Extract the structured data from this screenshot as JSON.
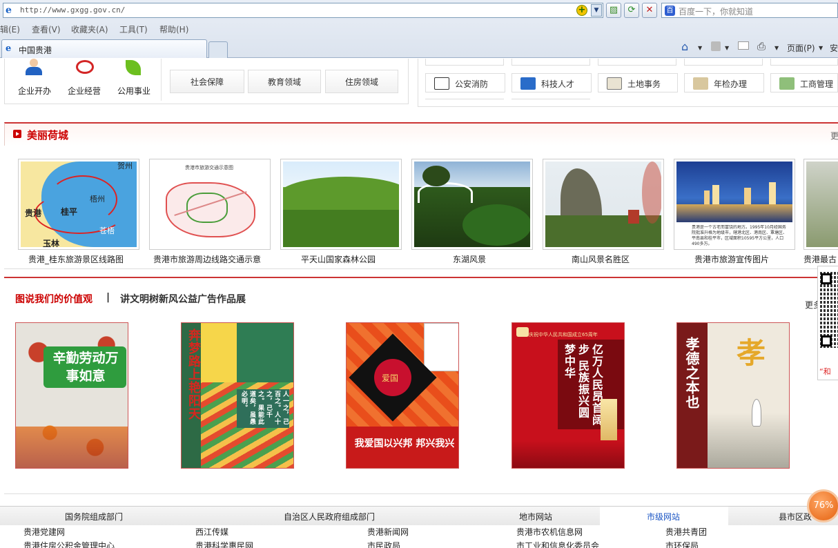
{
  "browser": {
    "url": "http://www.gxgg.gov.cn/",
    "search_placeholder": "百度一下，你就知道",
    "menu": [
      "辑(E)",
      "查看(V)",
      "收藏夹(A)",
      "工具(T)",
      "帮助(H)"
    ],
    "tab_title": "中国贵港",
    "commands": {
      "page": "页面(P)",
      "safety": "安"
    }
  },
  "services": {
    "left_items": [
      {
        "label": "企业开办",
        "icon": "person-icon"
      },
      {
        "label": "企业经营",
        "icon": "seal-icon"
      },
      {
        "label": "公用事业",
        "icon": "leaf-icon"
      }
    ],
    "middle_buttons": [
      "社会保障",
      "教育领域",
      "住房领域"
    ],
    "right_buttons": [
      {
        "label": "公安消防",
        "icon": "chart-icon"
      },
      {
        "label": "科技人才",
        "icon": "graduation-icon"
      },
      {
        "label": "土地事务",
        "icon": "book-icon"
      },
      {
        "label": "年检办理",
        "icon": "document-icon"
      },
      {
        "label": "工商管理",
        "icon": "money-icon"
      }
    ]
  },
  "beauty": {
    "title": "美丽荷城",
    "more": "更",
    "items": [
      {
        "caption": "贵港_桂东旅游景区线路图",
        "map_labels": [
          "贵港",
          "桂平",
          "梧州",
          "玉林",
          "苍梧",
          "贺州"
        ]
      },
      {
        "caption": "贵港市旅游周边线路交通示意",
        "map_title": "贵港市旅游交通示意图"
      },
      {
        "caption": "平天山国家森林公园"
      },
      {
        "caption": "东湖风景"
      },
      {
        "caption": "南山风景名胜区"
      },
      {
        "caption": "贵港市旅游宣传图片",
        "photo_text": "贵港是一个古老而富饶的地方。1995年10月经国务院批准升格为地级市，辖港北区、港南区、覃塘区、平南县和桂平市，区域面积10595平方公里，人口490多万。"
      },
      {
        "caption": "贵港最古"
      }
    ]
  },
  "values": {
    "tab_active": "图说我们的价值观",
    "separator": "|",
    "tab_other": "讲文明树新风公益广告作品展",
    "more": "更多",
    "posters": [
      {
        "title": "辛勤劳动万事如意"
      },
      {
        "title": "奔梦路上艳阳天",
        "text": "人一之，己百之。人十之，己千之。果能此道矣，虽愚必明。"
      },
      {
        "title": "我爱国以兴邦 邦兴我兴",
        "badge": "爱国"
      },
      {
        "title": "亿万人民昂首阔步 民族振兴圆梦中华",
        "header": "庆祝中华人民共和国成立65周年"
      },
      {
        "title": "孝德之本也",
        "char": "孝"
      }
    ],
    "qr_caption": "“和",
    "zoom": "76%"
  },
  "footer": {
    "tabs": [
      "国务院组成部门",
      "自治区人民政府组成部门",
      "地市网站",
      "市级网站",
      "县市区政"
    ],
    "active_tab": "市级网站",
    "links_row1": [
      "贵港党建网",
      "西江传媒",
      "贵港新闻网",
      "贵港市农机信息网",
      "贵港共青团"
    ],
    "links_row2": [
      "贵港住房公积金管理中心",
      "贵港科学惠民网",
      "市民政局",
      "市工业和信息化委员会",
      "市环保局"
    ]
  }
}
